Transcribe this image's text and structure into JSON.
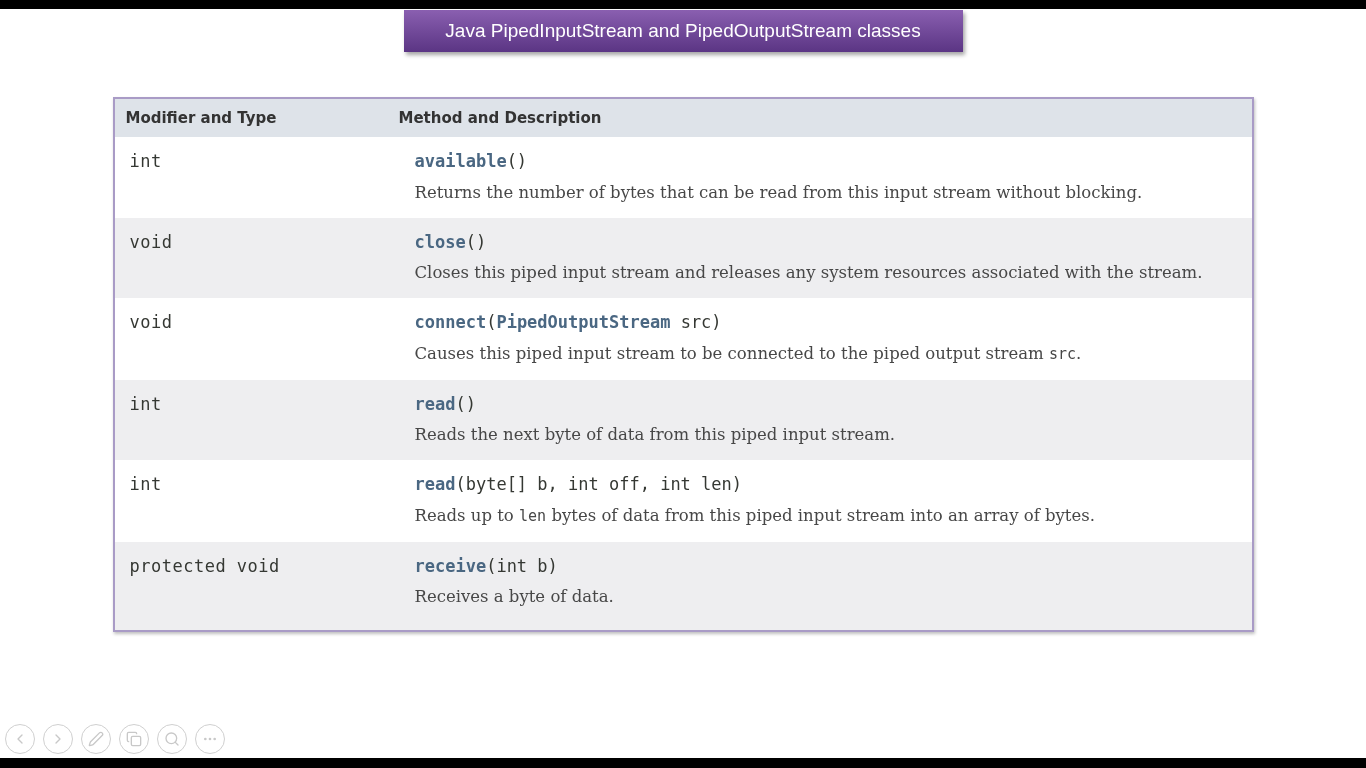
{
  "slide": {
    "title": "Java PipedInputStream and PipedOutputStream classes",
    "table": {
      "columns": [
        "Modifier and Type",
        "Method and Description"
      ],
      "rows": [
        {
          "type": "int",
          "method": "**available**()",
          "description": [
            {
              "kind": "text",
              "text": "Returns the number of bytes that can be read from this input stream without blocking."
            }
          ]
        },
        {
          "type": "void",
          "method": "**close**()",
          "description": [
            {
              "kind": "text",
              "text": "Closes this piped input stream and releases any system resources associated with the stream."
            }
          ]
        },
        {
          "type": "void",
          "method": "**connect**(**PipedOutputStream** src)",
          "description": [
            {
              "kind": "text",
              "text": "Causes this piped input stream to be connected to the piped output stream "
            },
            {
              "kind": "code",
              "text": "src"
            },
            {
              "kind": "text",
              "text": "."
            }
          ]
        },
        {
          "type": "int",
          "method": "**read**()",
          "description": [
            {
              "kind": "text",
              "text": "Reads the next byte of data from this piped input stream."
            }
          ]
        },
        {
          "type": "int",
          "method": "**read**(byte[] b, int off, int len)",
          "description": [
            {
              "kind": "text",
              "text": "Reads up to "
            },
            {
              "kind": "code",
              "text": "len"
            },
            {
              "kind": "text",
              "text": " bytes of data from this piped input stream into an array of bytes."
            }
          ]
        },
        {
          "type": "protected void",
          "method": "**receive**(int b)",
          "description": [
            {
              "kind": "text",
              "text": "Receives a byte of data."
            }
          ]
        }
      ]
    }
  },
  "controls": [
    {
      "kind": "previous"
    },
    {
      "kind": "next"
    },
    {
      "kind": "pen"
    },
    {
      "kind": "slides"
    },
    {
      "kind": "zoom"
    },
    {
      "kind": "more"
    }
  ]
}
